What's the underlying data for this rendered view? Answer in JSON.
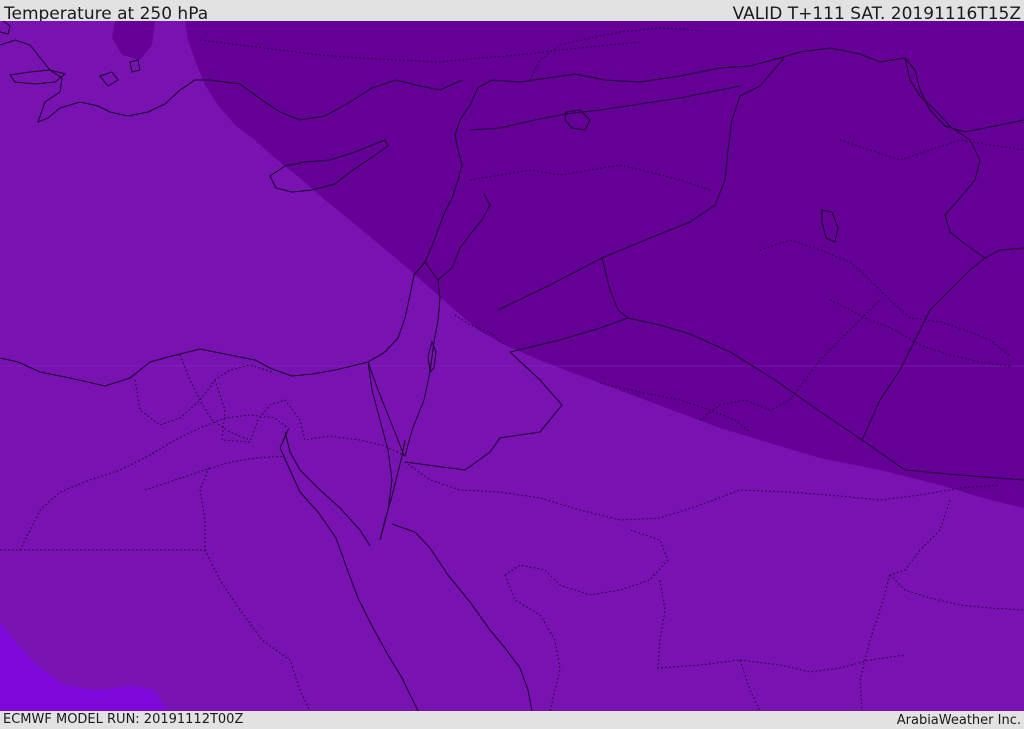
{
  "header": {
    "title": "Temperature at 250 hPa",
    "valid": "VALID T+111 SAT. 20191116T15Z"
  },
  "footer": {
    "model_run": "ECMWF MODEL RUN: 20191112T00Z",
    "credit": "ArabiaWeather Inc."
  },
  "map": {
    "field": "Temperature",
    "level": "250 hPa",
    "colors": {
      "cold_band": "#650096",
      "mid_band": "#7813b2",
      "warm_band": "#7e07da",
      "lines": "#1b0030",
      "bars": "#e2e2e2"
    }
  }
}
